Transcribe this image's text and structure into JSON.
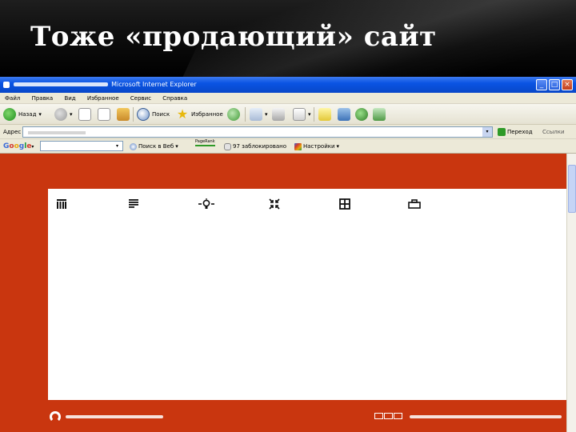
{
  "slide": {
    "title": "Тоже «продающий» сайт"
  },
  "browser": {
    "window_title": "Microsoft Internet Explorer",
    "window_buttons": [
      "_",
      "□",
      "×"
    ],
    "menu": [
      "Файл",
      "Правка",
      "Вид",
      "Избранное",
      "Сервис",
      "Справка"
    ],
    "toolbar": {
      "back_label": "Назад",
      "search_label": "Поиск",
      "favorites_label": "Избранное"
    },
    "address": {
      "label": "Адрес",
      "go_label": "Переход",
      "links_label": "Ссылки"
    },
    "google_bar": {
      "logo": [
        "G",
        "o",
        "o",
        "g",
        "l",
        "e"
      ],
      "search_web_label": "Поиск в Веб",
      "pagerank_label": "PageRank",
      "popups_label": "97 заблокировано",
      "settings_label": "Настройки"
    }
  },
  "colors": {
    "page_background": "#c9360f",
    "panel_background": "#ffffff",
    "titlebar_blue": "#0a54e3"
  },
  "page": {
    "nav_icons": [
      "columns-icon",
      "list-icon",
      "bulb-icon",
      "shrink-icon",
      "grid-icon",
      "case-icon"
    ]
  }
}
